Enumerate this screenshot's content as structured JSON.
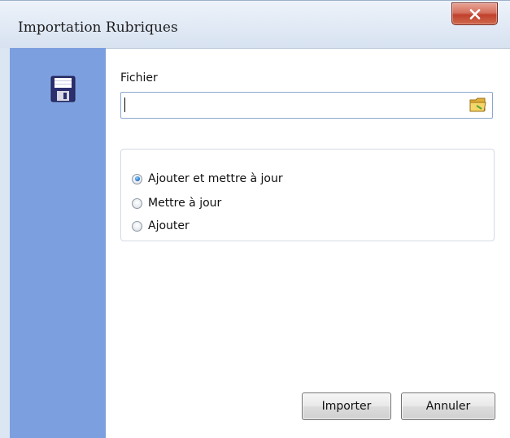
{
  "window": {
    "title": "Importation Rubriques",
    "close_icon": "close-icon"
  },
  "sidebar": {
    "icon": "floppy-disk-icon",
    "accent_color": "#7c9fdf"
  },
  "file": {
    "label": "Fichier",
    "value": "",
    "placeholder": "",
    "browse_icon": "folder-icon"
  },
  "options": {
    "items": [
      {
        "label": "Ajouter et mettre à jour",
        "checked": true
      },
      {
        "label": "Mettre à jour",
        "checked": false
      },
      {
        "label": "Ajouter",
        "checked": false
      }
    ]
  },
  "buttons": {
    "import_label": "Importer",
    "cancel_label": "Annuler"
  }
}
